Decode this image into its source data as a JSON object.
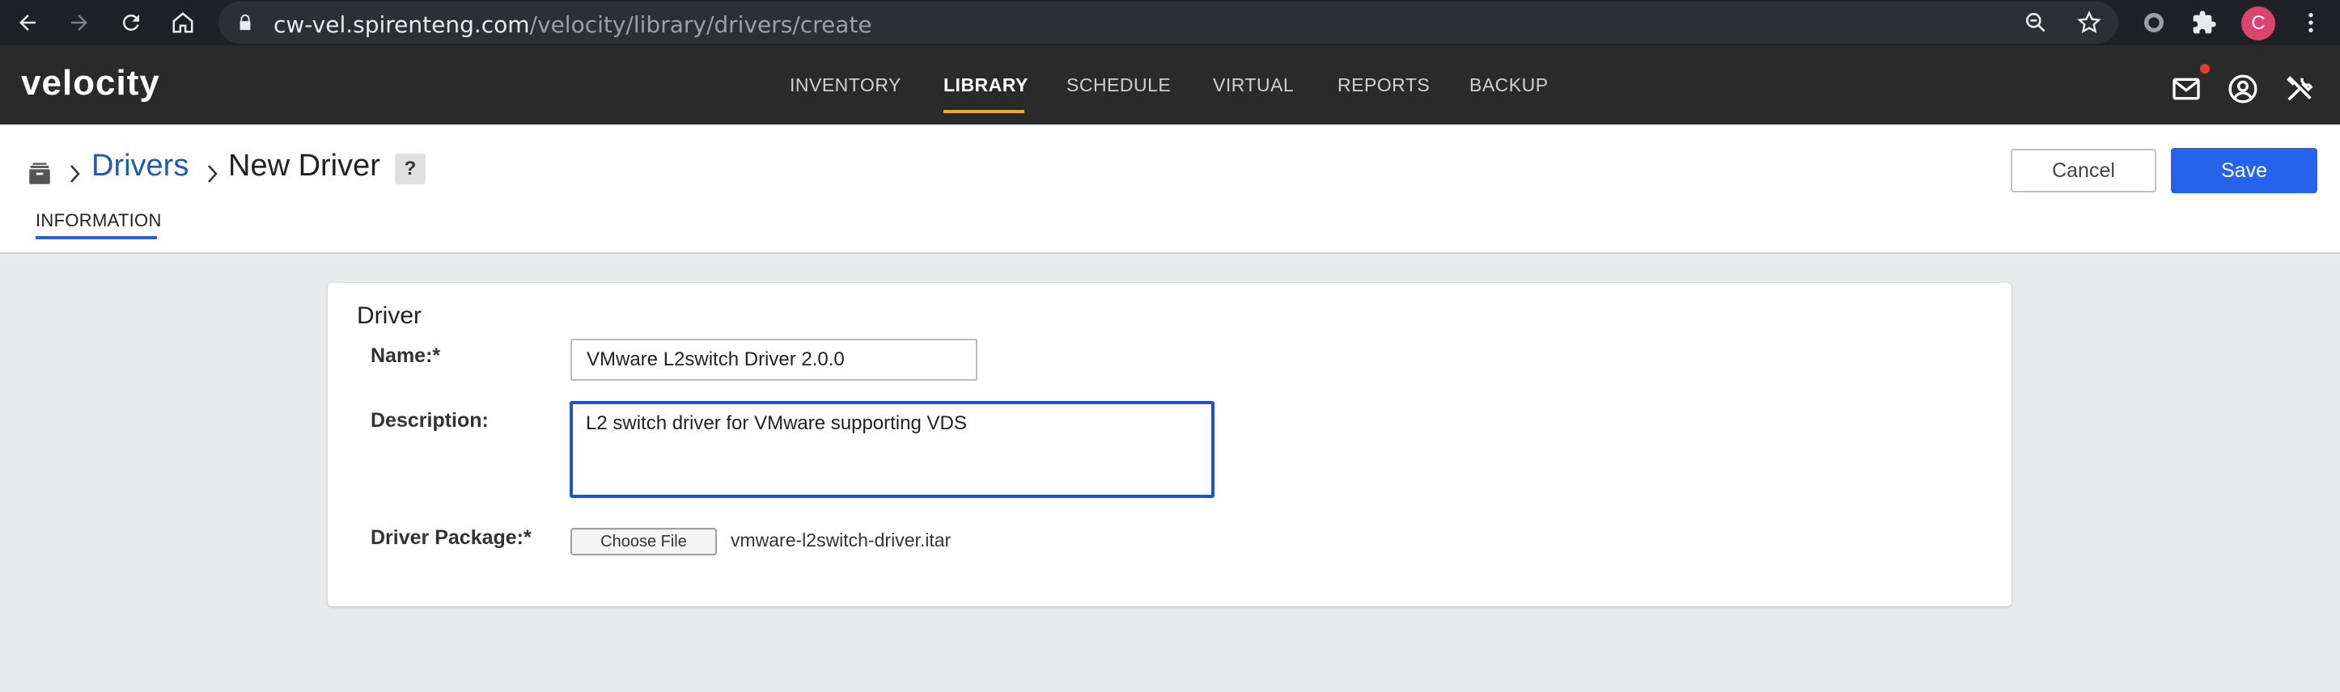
{
  "browser": {
    "url_host": "cw-vel.spirenteng.com",
    "url_path": "/velocity/library/drivers/create",
    "profile_initial": "C"
  },
  "app": {
    "logo": "velocity",
    "nav": [
      {
        "label": "INVENTORY",
        "active": false
      },
      {
        "label": "LIBRARY",
        "active": true
      },
      {
        "label": "SCHEDULE",
        "active": false
      },
      {
        "label": "VIRTUAL",
        "active": false
      },
      {
        "label": "REPORTS",
        "active": false
      },
      {
        "label": "BACKUP",
        "active": false
      }
    ],
    "accent_color": "#f5a623"
  },
  "breadcrumb": {
    "parent": "Drivers",
    "current": "New Driver",
    "help": "?"
  },
  "tabs": {
    "information": "INFORMATION"
  },
  "actions": {
    "cancel": "Cancel",
    "save": "Save",
    "save_color": "#2563eb"
  },
  "form": {
    "section_title": "Driver",
    "name_label": "Name:*",
    "name_value": "VMware L2switch Driver 2.0.0",
    "description_label": "Description:",
    "description_value": "L2 switch driver for VMware supporting VDS",
    "package_label": "Driver Package:*",
    "choose_file_label": "Choose File",
    "package_file": "vmware-l2switch-driver.itar"
  }
}
